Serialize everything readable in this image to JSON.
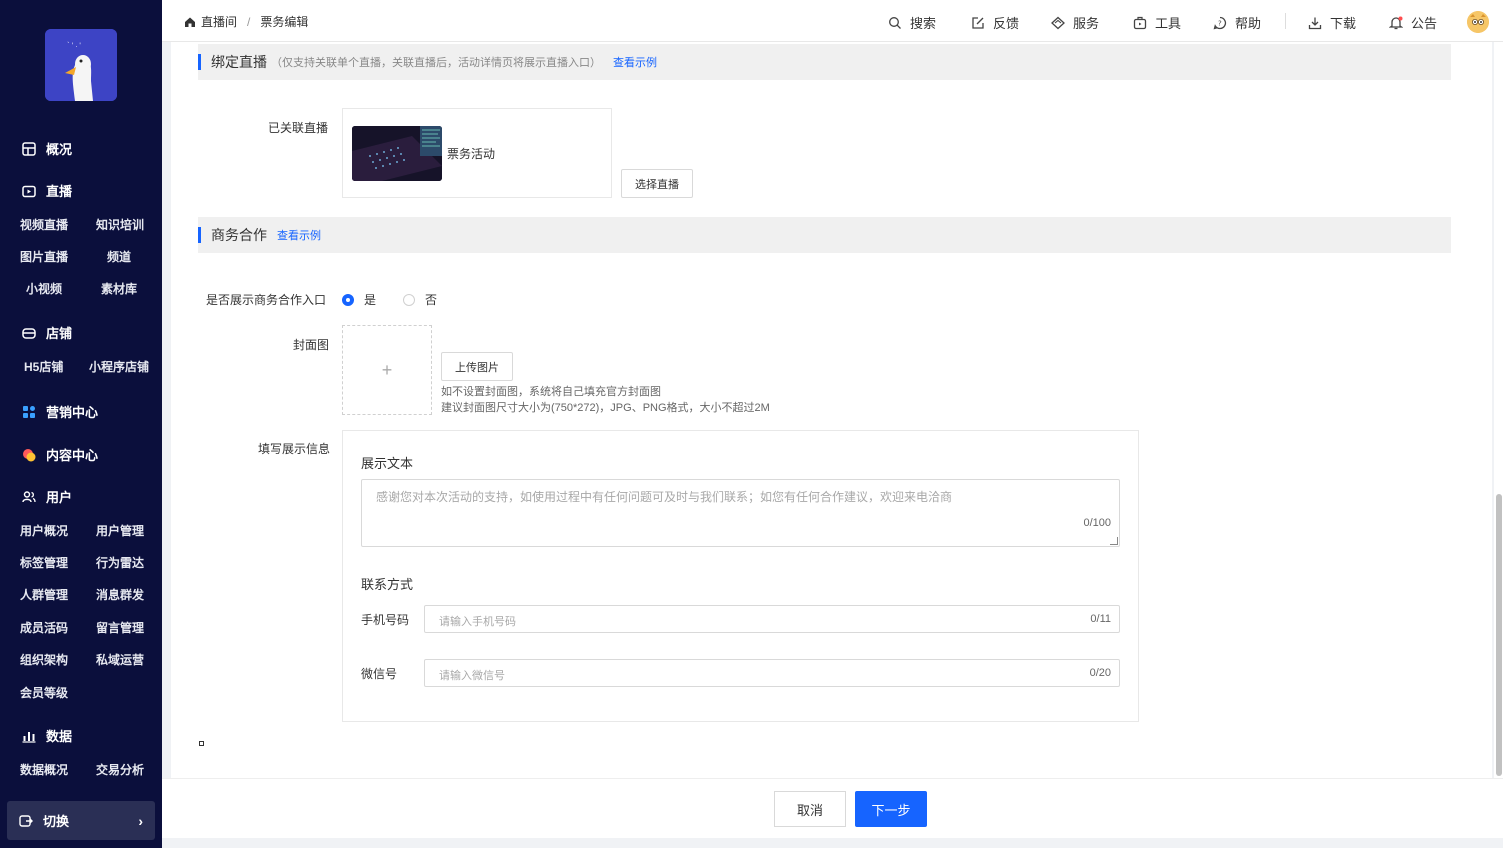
{
  "sidebar": {
    "sections": {
      "overview": "概况",
      "live": "直播",
      "shop": "店铺",
      "marketing": "营销中心",
      "content": "内容中心",
      "users": "用户",
      "data": "数据"
    },
    "live_items": [
      "视频直播",
      "知识培训",
      "图片直播",
      "频道",
      "小视频",
      "素材库"
    ],
    "shop_items": [
      "H5店铺",
      "小程序店铺"
    ],
    "user_items": [
      "用户概况",
      "用户管理",
      "标签管理",
      "行为雷达",
      "人群管理",
      "消息群发",
      "成员活码",
      "留言管理",
      "组织架构",
      "私域运营",
      "会员等级"
    ],
    "data_items": [
      "数据概况",
      "交易分析"
    ],
    "switch_label": "切换"
  },
  "topbar": {
    "breadcrumb": [
      "直播间",
      "票务编辑"
    ],
    "nav": {
      "search": "搜索",
      "feedback": "反馈",
      "service": "服务",
      "tools": "工具",
      "help": "帮助",
      "download": "下载",
      "notice": "公告"
    }
  },
  "bind_live": {
    "title": "绑定直播",
    "note": "（仅支持关联单个直播，关联直播后，活动详情页将展示直播入口）",
    "example_link": "查看示例",
    "linked_label": "已关联直播",
    "linked_name": "票务活动",
    "select_button": "选择直播"
  },
  "business": {
    "title": "商务合作",
    "example_link": "查看示例",
    "show_entry_label": "是否展示商务合作入口",
    "option_yes": "是",
    "option_no": "否",
    "selected": "是",
    "cover_label": "封面图",
    "upload_plus": "+",
    "upload_button": "上传图片",
    "hint1": "如不设置封面图，系统将自己填充官方封面图",
    "hint2": "建议封面图尺寸大小为(750*272)，JPG、PNG格式，大小不超过2M",
    "info_label": "填写展示信息",
    "display_text_heading": "展示文本",
    "display_text_placeholder": "感谢您对本次活动的支持，如使用过程中有任何问题可及时与我们联系；如您有任何合作建议，欢迎来电洽商",
    "display_text_count": "0/100",
    "contact_heading": "联系方式",
    "phone_label": "手机号码",
    "phone_placeholder": "请输入手机号码",
    "phone_count": "0/11",
    "wechat_label": "微信号",
    "wechat_placeholder": "请输入微信号",
    "wechat_count": "0/20"
  },
  "footer": {
    "cancel": "取消",
    "next": "下一步"
  },
  "colors": {
    "sidebar_bg": "#0b0f3c",
    "accent": "#1664ff"
  }
}
